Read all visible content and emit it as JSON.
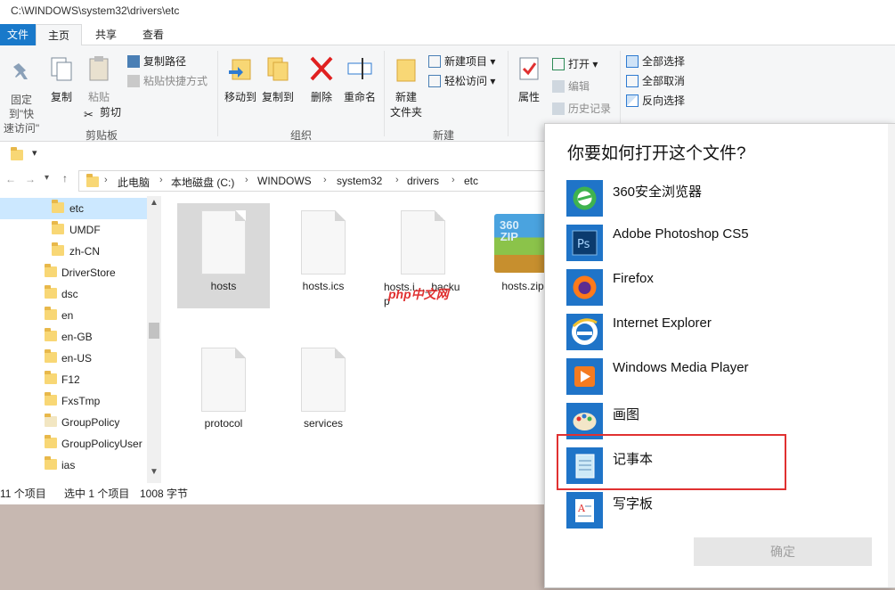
{
  "window": {
    "path": "C:\\WINDOWS\\system32\\drivers\\etc"
  },
  "tabs": {
    "file": "文件",
    "home": "主页",
    "share": "共享",
    "view": "查看"
  },
  "ribbon": {
    "clipboard": {
      "pin": "固定到\"快\n速访问\"",
      "pin_line1": "固定到\"快",
      "pin_line2": "速访问\"",
      "copy": "复制",
      "paste": "粘贴",
      "copy_path": "复制路径",
      "paste_shortcut": "粘贴快捷方式",
      "cut": "剪切",
      "label": "剪贴板"
    },
    "organize": {
      "move_to": "移动到",
      "copy_to": "复制到",
      "delete": "删除",
      "rename": "重命名",
      "label": "组织"
    },
    "new": {
      "new_folder_line1": "新建",
      "new_folder_line2": "文件夹",
      "new_item": "新建项目",
      "easy_access": "轻松访问",
      "label": "新建"
    },
    "open": {
      "properties": "属性",
      "open": "打开",
      "edit": "编辑",
      "history": "历史记录"
    },
    "select": {
      "select_all": "全部选择",
      "select_none": "全部取消",
      "invert": "反向选择"
    }
  },
  "breadcrumb": [
    "此电脑",
    "本地磁盘 (C:)",
    "WINDOWS",
    "system32",
    "drivers",
    "etc"
  ],
  "navpane": [
    "etc",
    "UMDF",
    "zh-CN",
    "DriverStore",
    "dsc",
    "en",
    "en-GB",
    "en-US",
    "F12",
    "FxsTmp",
    "GroupPolicy",
    "GroupPolicyUser",
    "ias"
  ],
  "files": [
    "hosts",
    "hosts.ics",
    "hosts.i…_backu\np",
    "hosts.zip",
    "protocol",
    "services"
  ],
  "file_names": {
    "f0": "hosts",
    "f1": "hosts.ics",
    "f2a": "hosts.i…_backu",
    "f2b": "p",
    "f3": "hosts.zip",
    "f4": "protocol",
    "f5": "services"
  },
  "zip_text": "360\nZIP",
  "zip_line1": "360",
  "zip_line2": "ZIP",
  "watermark": "php中文网",
  "status": {
    "count": "11 个项目",
    "selected": "选中 1 个项目",
    "size": "1008 字节"
  },
  "dialog": {
    "title": "你要如何打开这个文件?",
    "apps": [
      "360安全浏览器",
      "Adobe Photoshop CS5",
      "Firefox",
      "Internet Explorer",
      "Windows Media Player",
      "画图",
      "记事本",
      "写字板"
    ],
    "ok": "确定"
  },
  "colors": {
    "accent": "#1979ca",
    "highlight_border": "#e03131",
    "tile_blue": "#1f74c8"
  }
}
